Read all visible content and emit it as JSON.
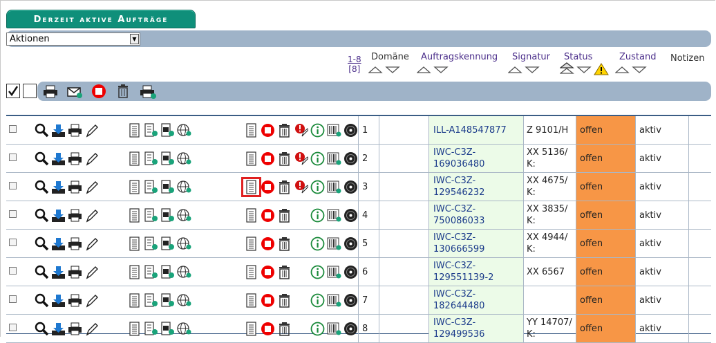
{
  "title": "Derzeit aktive Aufträge",
  "actions_select": {
    "value": "Aktionen"
  },
  "range": {
    "label": "1-8",
    "total": "[8]"
  },
  "columns": {
    "domain": "Domäne",
    "order_id": "Auftragskennung",
    "signature": "Signatur",
    "status": "Status",
    "state": "Zustand",
    "notes": "Notizen"
  },
  "rows": [
    {
      "num": "1",
      "order_id": "ILL-A148547877",
      "signature": "Z 9101/H",
      "status": "offen",
      "state": "aktiv",
      "has_extra": true
    },
    {
      "num": "2",
      "order_id": "IWC-C3Z-169036480",
      "signature": "XX 5136/ K:",
      "status": "offen",
      "state": "aktiv",
      "has_extra": true
    },
    {
      "num": "3",
      "order_id": "IWC-C3Z-129546232",
      "signature": "XX 4675/ K:",
      "status": "offen",
      "state": "aktiv",
      "has_extra": true
    },
    {
      "num": "4",
      "order_id": "IWC-C3Z-750086033",
      "signature": "XX 3835/ K:",
      "status": "offen",
      "state": "aktiv",
      "has_extra": false
    },
    {
      "num": "5",
      "order_id": "IWC-C3Z-130666599",
      "signature": "XX 4944/ K:",
      "status": "offen",
      "state": "aktiv",
      "has_extra": false
    },
    {
      "num": "6",
      "order_id": "IWC-C3Z-129551139-2",
      "signature": "XX 6567",
      "status": "offen",
      "state": "aktiv",
      "has_extra": false
    },
    {
      "num": "7",
      "order_id": "IWC-C3Z-182644480",
      "signature": "",
      "status": "offen",
      "state": "aktiv",
      "has_extra": false
    },
    {
      "num": "8",
      "order_id": "IWC-C3Z-129499536",
      "signature": "YY 14707/ K:",
      "status": "offen",
      "state": "aktiv",
      "has_extra": false
    }
  ],
  "colors": {
    "status_bg": "#f79646",
    "order_bg": "#ecfbe8",
    "bar": "#9fb3c8",
    "title_bg": "#0f8f7a"
  }
}
